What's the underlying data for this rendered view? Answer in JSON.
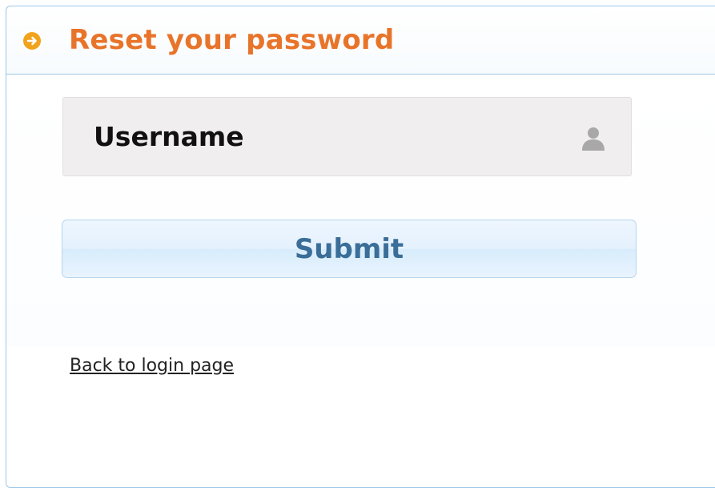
{
  "panel": {
    "title": "Reset your password",
    "header_icon": "arrow-right-circle-icon",
    "accent_color": "#e8742a"
  },
  "form": {
    "username": {
      "placeholder": "Username",
      "value": "",
      "icon": "user-icon"
    },
    "submit_label": "Submit"
  },
  "footer": {
    "back_link_label": "Back to login page"
  }
}
